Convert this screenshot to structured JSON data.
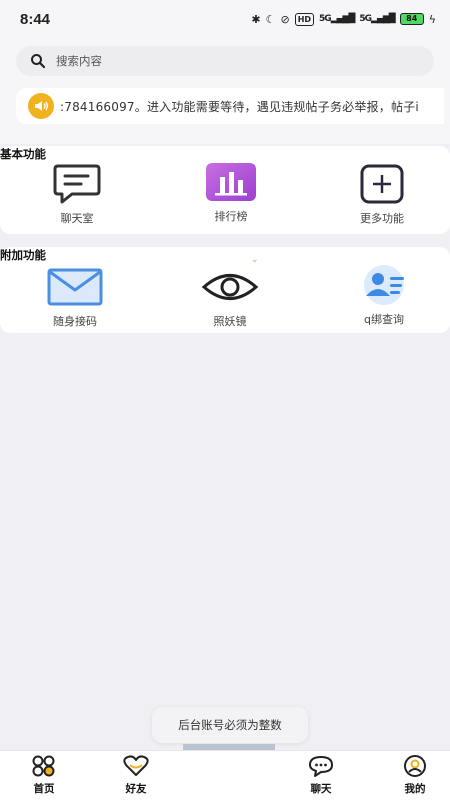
{
  "status_bar": {
    "time": "8:44",
    "network_label": "5G",
    "hd_label": "HD",
    "battery": "84"
  },
  "search": {
    "placeholder": "搜索内容"
  },
  "notice": {
    "text": ":784166097。进入功能需要等待，遇见违规帖子务必举报，帖子i"
  },
  "basic_section": {
    "title": "基本功能",
    "items": [
      {
        "label": "聊天室",
        "icon": "chat-bubble-icon"
      },
      {
        "label": "排行榜",
        "icon": "ranking-chart-icon"
      },
      {
        "label": "更多功能",
        "icon": "plus-square-icon"
      }
    ]
  },
  "extra_section": {
    "title": "附加功能",
    "items": [
      {
        "label": "随身接码",
        "icon": "envelope-icon"
      },
      {
        "label": "照妖镜",
        "icon": "eye-icon"
      },
      {
        "label": "q绑查询",
        "icon": "user-card-icon"
      }
    ]
  },
  "toast": {
    "text": "后台账号必须为整数"
  },
  "tabbar": {
    "items": [
      {
        "label": "首页",
        "icon": "home-grid-icon"
      },
      {
        "label": "好友",
        "icon": "heart-icon"
      },
      {
        "label": "聊天",
        "icon": "chat-icon"
      },
      {
        "label": "我的",
        "icon": "profile-icon"
      }
    ]
  },
  "colors": {
    "accent_yellow": "#f0b31f",
    "rank_purple": "#b15ad8",
    "mail_blue": "#4a8fe0",
    "background": "#efeff4"
  }
}
